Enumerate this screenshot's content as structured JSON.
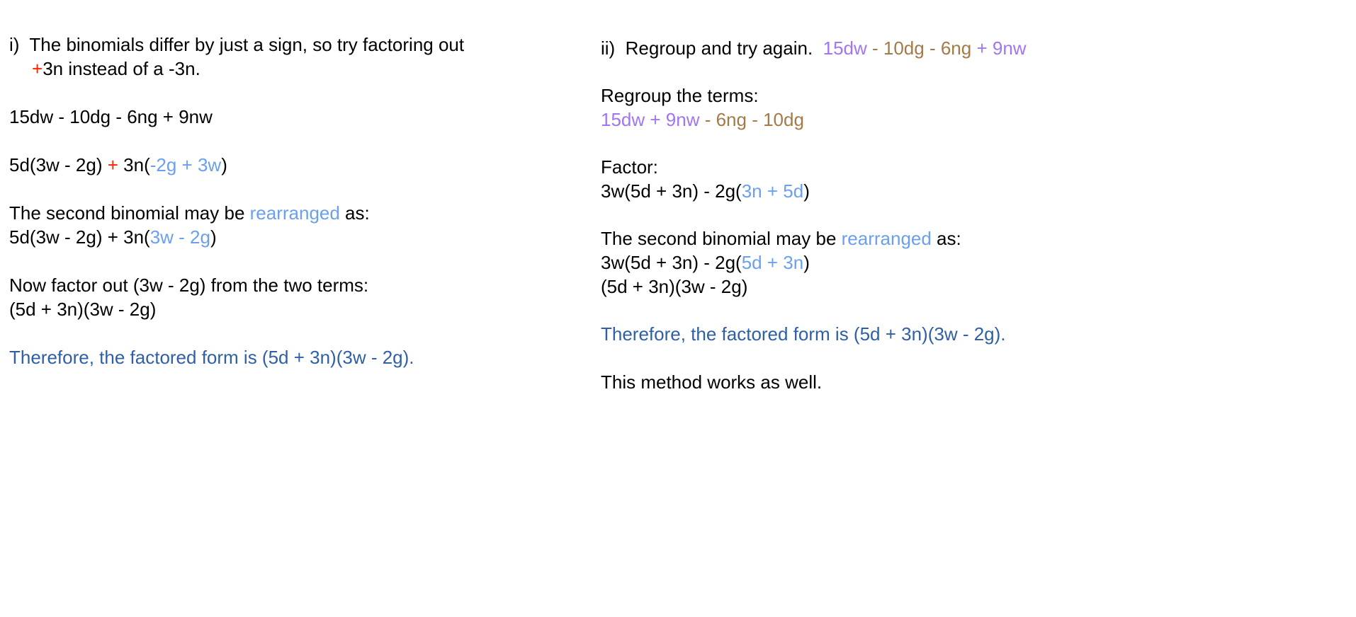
{
  "colors": {
    "red": "#ff2200",
    "light_blue": "#6aa0ef",
    "purple": "#a275f5",
    "brown": "#a37a48",
    "navy": "#2f5fa5"
  },
  "left": {
    "intro_line1": "i)  The binomials differ by just a sign, so try factoring out",
    "intro_line2_sign": "+",
    "intro_line2_rest": "3n instead of a -3n.",
    "expression": "15dw - 10dg - 6ng + 9nw",
    "step1_a": "5d(3w - 2g) ",
    "step1_plus": "+",
    "step1_b": " 3n(",
    "step1_inner": "-2g + 3w",
    "step1_close": ")",
    "rearrange_a": "The second binomial may be ",
    "rearrange_word": "rearranged",
    "rearrange_b": " as:",
    "step2_a": "5d(3w - 2g) + 3n(",
    "step2_inner": "3w - 2g",
    "step2_close": ")",
    "factor_out": "Now factor out (3w - 2g) from the two terms:",
    "factored": "(5d + 3n)(3w - 2g)",
    "conclusion": "Therefore, the factored form is (5d + 3n)(3w - 2g)."
  },
  "right": {
    "intro": "ii)  Regroup and try again.  ",
    "expr_a": "15dw",
    "expr_op1": " - ",
    "expr_b": "10dg - 6ng",
    "expr_op2": " + ",
    "expr_c": "9nw",
    "regroup_label": "Regroup the terms:",
    "regroup_a": "15dw + 9nw",
    "regroup_op": " - ",
    "regroup_b": "6ng - 10dg",
    "factor_label": "Factor:",
    "factor_a": "3w(5d + 3n) - 2g(",
    "factor_inner": "3n + 5d",
    "factor_close": ")",
    "rearrange_a": "The second binomial may be ",
    "rearrange_word": "rearranged",
    "rearrange_b": " as:",
    "step2_a": "3w(5d + 3n) - 2g(",
    "step2_inner": "5d + 3n",
    "step2_close": ")",
    "factored": "(5d + 3n)(3w - 2g)",
    "conclusion": "Therefore, the factored form is (5d + 3n)(3w - 2g).",
    "closing": "This method works as well."
  }
}
